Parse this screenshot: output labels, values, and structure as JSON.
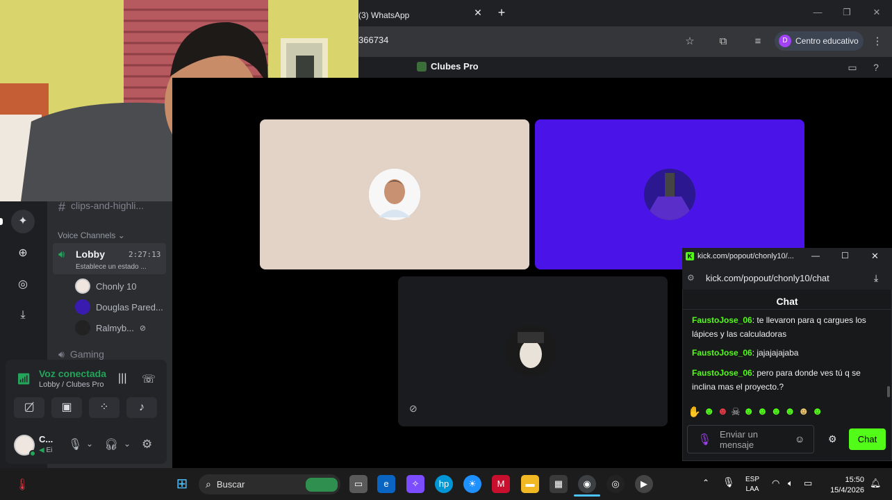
{
  "browser": {
    "tab_title": "(3) WhatsApp",
    "tab_close": "✕",
    "tab_new": "+",
    "url_fragment": "366734",
    "profile_initial": "D",
    "profile_name": "Centro educativo",
    "window_controls": [
      "—",
      "❐",
      "✕"
    ]
  },
  "discord": {
    "server_name": "Clubes Pro",
    "text_channel": "clips-and-highli...",
    "voice_section": "Voice Channels",
    "lobby": {
      "name": "Lobby",
      "timer": "2:27:13",
      "status": "Establece un estado ..."
    },
    "members": [
      {
        "name": "Chonly 10"
      },
      {
        "name": "Douglas Pared..."
      },
      {
        "name": "Ralmyb..."
      }
    ],
    "gaming_channel": "Gaming",
    "voice_panel": {
      "status": "Voz conectada",
      "location": "Lobby / Clubes Pro"
    },
    "user_panel": {
      "name": "C...",
      "sub": "Ei"
    }
  },
  "popup": {
    "title": "kick.com/popout/chonly10/...",
    "url": "kick.com/popout/chonly10/chat",
    "chat_header": "Chat",
    "messages": [
      {
        "user": "FaustoJose_06",
        "text": ": te llevaron para q cargues los lápices y las calculadoras"
      },
      {
        "user": "FaustoJose_06",
        "text": ": jajajajajaba"
      },
      {
        "user": "FaustoJose_06",
        "text": ": pero para donde ves tú q se inclina mas el proyecto.?"
      }
    ],
    "input_placeholder": "Enviar un mensaje",
    "send_label": "Chat",
    "colors": {
      "accent": "#53fc18"
    }
  },
  "taskbar": {
    "search_label": "Buscar",
    "lang_top": "ESP",
    "lang_bottom": "LAA",
    "time": "15:50",
    "date": "15/4/2026"
  }
}
